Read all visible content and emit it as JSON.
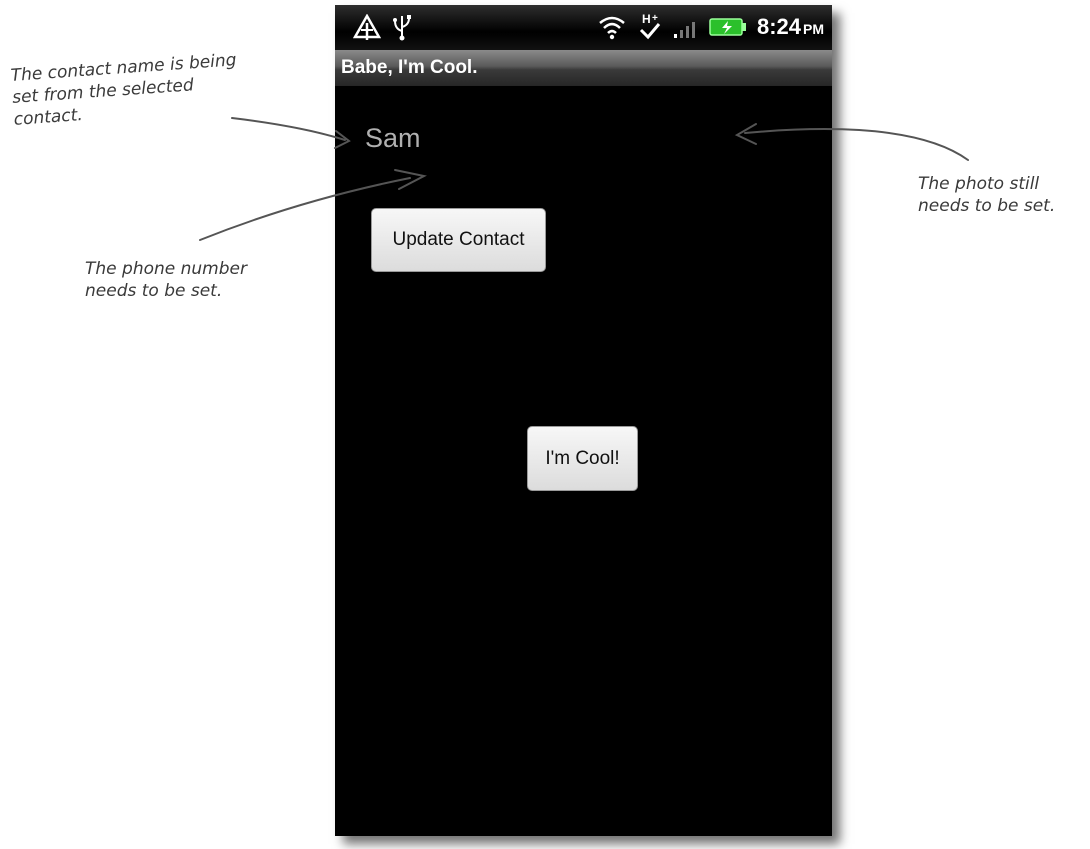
{
  "status_bar": {
    "time": "8:24",
    "ampm": "PM",
    "icons": [
      "alert-icon",
      "usb-icon",
      "wifi-icon",
      "hplus-network-icon",
      "signal-icon",
      "battery-charging-icon"
    ]
  },
  "app": {
    "title": "Babe, I'm Cool."
  },
  "contact": {
    "name": "Sam"
  },
  "buttons": {
    "update_contact": "Update Contact",
    "im_cool": "I'm Cool!"
  },
  "annotations": {
    "contact_name": "The contact name is being set from the selected contact.",
    "phone_number": "The phone number needs to be set.",
    "photo": "The photo still needs to be set."
  },
  "colors": {
    "screen_background": "#000000",
    "contact_text": "#b0b0b0",
    "annotation_text": "#3a3a3a"
  }
}
